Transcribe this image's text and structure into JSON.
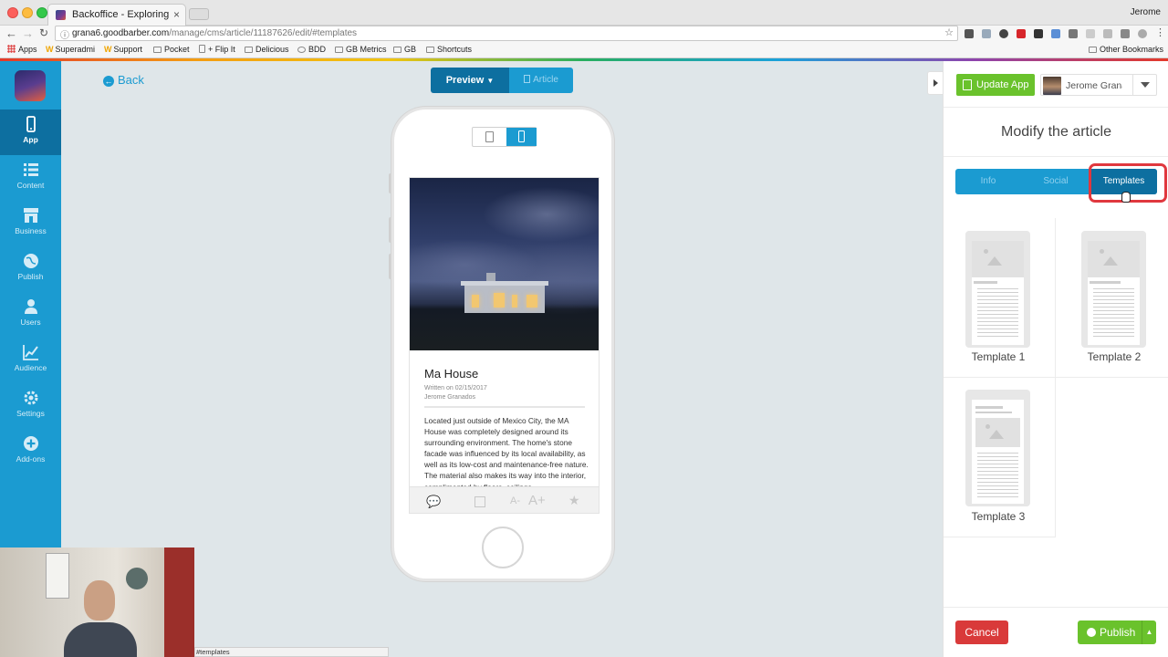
{
  "browser": {
    "tab_title": "Backoffice - Exploring",
    "tab_close": "×",
    "profile_name": "Jerome",
    "url_host": "grana6.goodbarber.com",
    "url_path": "/manage/cms/article/11187626/edit/#templates",
    "status_url": "#templates",
    "bookmarks": [
      {
        "label": "Apps"
      },
      {
        "label": "Superadmi"
      },
      {
        "label": "Support"
      },
      {
        "label": "Pocket"
      },
      {
        "label": "+ Flip It"
      },
      {
        "label": "Delicious"
      },
      {
        "label": "BDD"
      },
      {
        "label": "GB Metrics"
      },
      {
        "label": "GB"
      },
      {
        "label": "Shortcuts"
      }
    ],
    "other_bookmarks": "Other Bookmarks"
  },
  "sidebar": {
    "items": [
      {
        "label": "App",
        "icon": "phone-icon",
        "active": true
      },
      {
        "label": "Content",
        "icon": "list-icon"
      },
      {
        "label": "Business",
        "icon": "store-icon"
      },
      {
        "label": "Publish",
        "icon": "globe-icon"
      },
      {
        "label": "Users",
        "icon": "user-icon"
      },
      {
        "label": "Audience",
        "icon": "chart-icon"
      },
      {
        "label": "Settings",
        "icon": "gear-icon"
      },
      {
        "label": "Add-ons",
        "icon": "plus-circle-icon"
      }
    ]
  },
  "main": {
    "back_label": "Back",
    "preview_label": "Preview",
    "article_label": "Article",
    "article": {
      "title": "Ma House",
      "date": "Written on 02/15/2017",
      "author": "Jerome Granados",
      "body": "Located just outside of Mexico City, the MA House was completely designed around its surrounding environment. The home's stone facade was influenced by its local availability, as well as its low-cost and maintenance-free nature. The material also makes its way into the interior, complimented by floors, ceilings"
    }
  },
  "panel": {
    "update_app_label": "Update App",
    "user_name": "Jerome Granados",
    "title": "Modify the article",
    "tabs": [
      {
        "label": "Info"
      },
      {
        "label": "Social"
      },
      {
        "label": "Templates",
        "active": true
      }
    ],
    "templates": [
      {
        "label": "Template 1"
      },
      {
        "label": "Template 2"
      },
      {
        "label": "Template 3"
      }
    ],
    "cancel_label": "Cancel",
    "publish_label": "Publish"
  },
  "colors": {
    "sidebar": "#1b9bd1",
    "sidebar_active": "#0d6fa0",
    "green": "#6ac22c",
    "red": "#d93a3a",
    "highlight": "#e0383e"
  }
}
